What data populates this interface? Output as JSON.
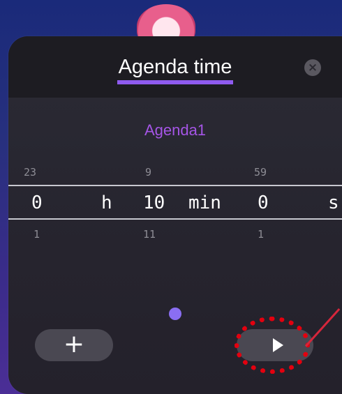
{
  "window": {
    "title": "Agenda time"
  },
  "agenda": {
    "name": "Agenda1"
  },
  "picker": {
    "hours": {
      "prev": "23",
      "value": "0",
      "next": "1",
      "unit": "h"
    },
    "minutes": {
      "prev": "9",
      "value": "10",
      "next": "11",
      "unit": "min"
    },
    "seconds": {
      "prev": "59",
      "value": "0",
      "next": "1",
      "unit": "s"
    }
  },
  "buttons": {
    "add_label": "+",
    "close_icon": "close-icon",
    "play_icon": "play-icon"
  },
  "colors": {
    "accent": "#8f5bf0",
    "agenda_text": "#a555e6",
    "panel_bg": "#26242e",
    "header_bg": "#1d1c22",
    "annotation_red": "#e3000f"
  }
}
